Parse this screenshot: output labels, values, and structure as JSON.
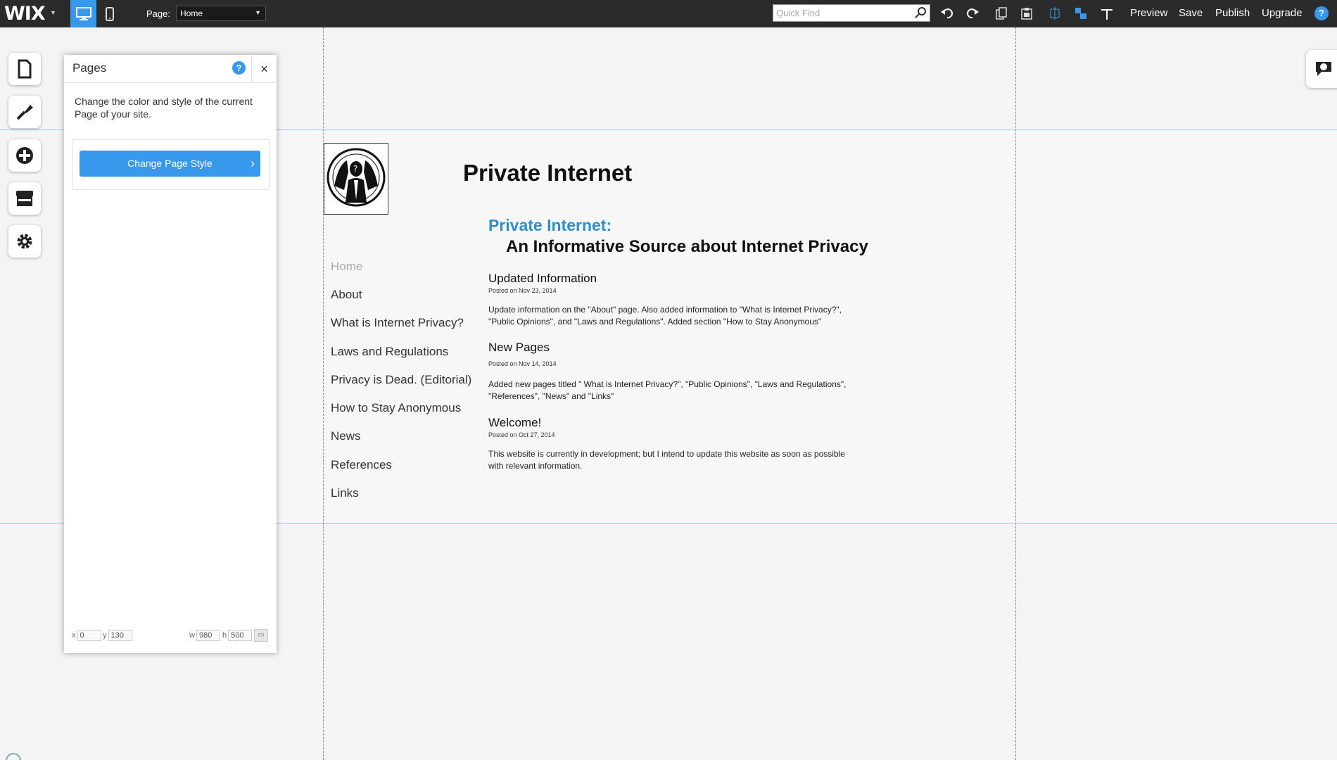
{
  "topbar": {
    "logo": "WIX",
    "page_label": "Page:",
    "page_value": "Home",
    "quickfind_placeholder": "Quick Find",
    "preview": "Preview",
    "save": "Save",
    "publish": "Publish",
    "upgrade": "Upgrade",
    "help": "?"
  },
  "panel": {
    "title": "Pages",
    "help": "?",
    "close": "×",
    "description": "Change the color and style of the current Page of your site.",
    "button_label": "Change Page Style",
    "x_label": "x",
    "x_value": "0",
    "y_label": "y",
    "y_value": "130",
    "w_label": "w",
    "w_value": "980",
    "h_label": "h",
    "h_value": "500"
  },
  "site": {
    "title": "Private Internet",
    "subtitle": "Private Internet:",
    "tagline": "An Informative Source about Internet Privacy",
    "nav": [
      "Home",
      "About",
      "What is Internet Privacy?",
      "Laws and Regulations",
      "Privacy is Dead. (Editorial)",
      "How to Stay Anonymous",
      "News",
      "References",
      "Links"
    ],
    "posts": [
      {
        "title": "Updated Information",
        "date": "Posted on Nov 23, 2014",
        "body": "Update information on the \"About\" page. Also added information to \"What is Internet Privacy?\", \"Public Opinions\", and \"Laws and Regulations\". Added section \"How to Stay Anonymous\""
      },
      {
        "title": "New Pages",
        "date": "Posted on Nov 14, 2014",
        "body": "Added new pages titled \" What is Internet Privacy?\", \"Public Opinions\", \"Laws and Regulations\", \"References\", \"News\" and \"Links\""
      },
      {
        "title": "Welcome!",
        "date": "Posted on Oct 27, 2014",
        "body": "This website is currently in development; but I intend to update this website as soon as possible with relevant information."
      }
    ]
  },
  "colors": {
    "topbar_bg": "#2b2b2b",
    "accent": "#3899ec",
    "subtitle": "#2f8fcc"
  }
}
